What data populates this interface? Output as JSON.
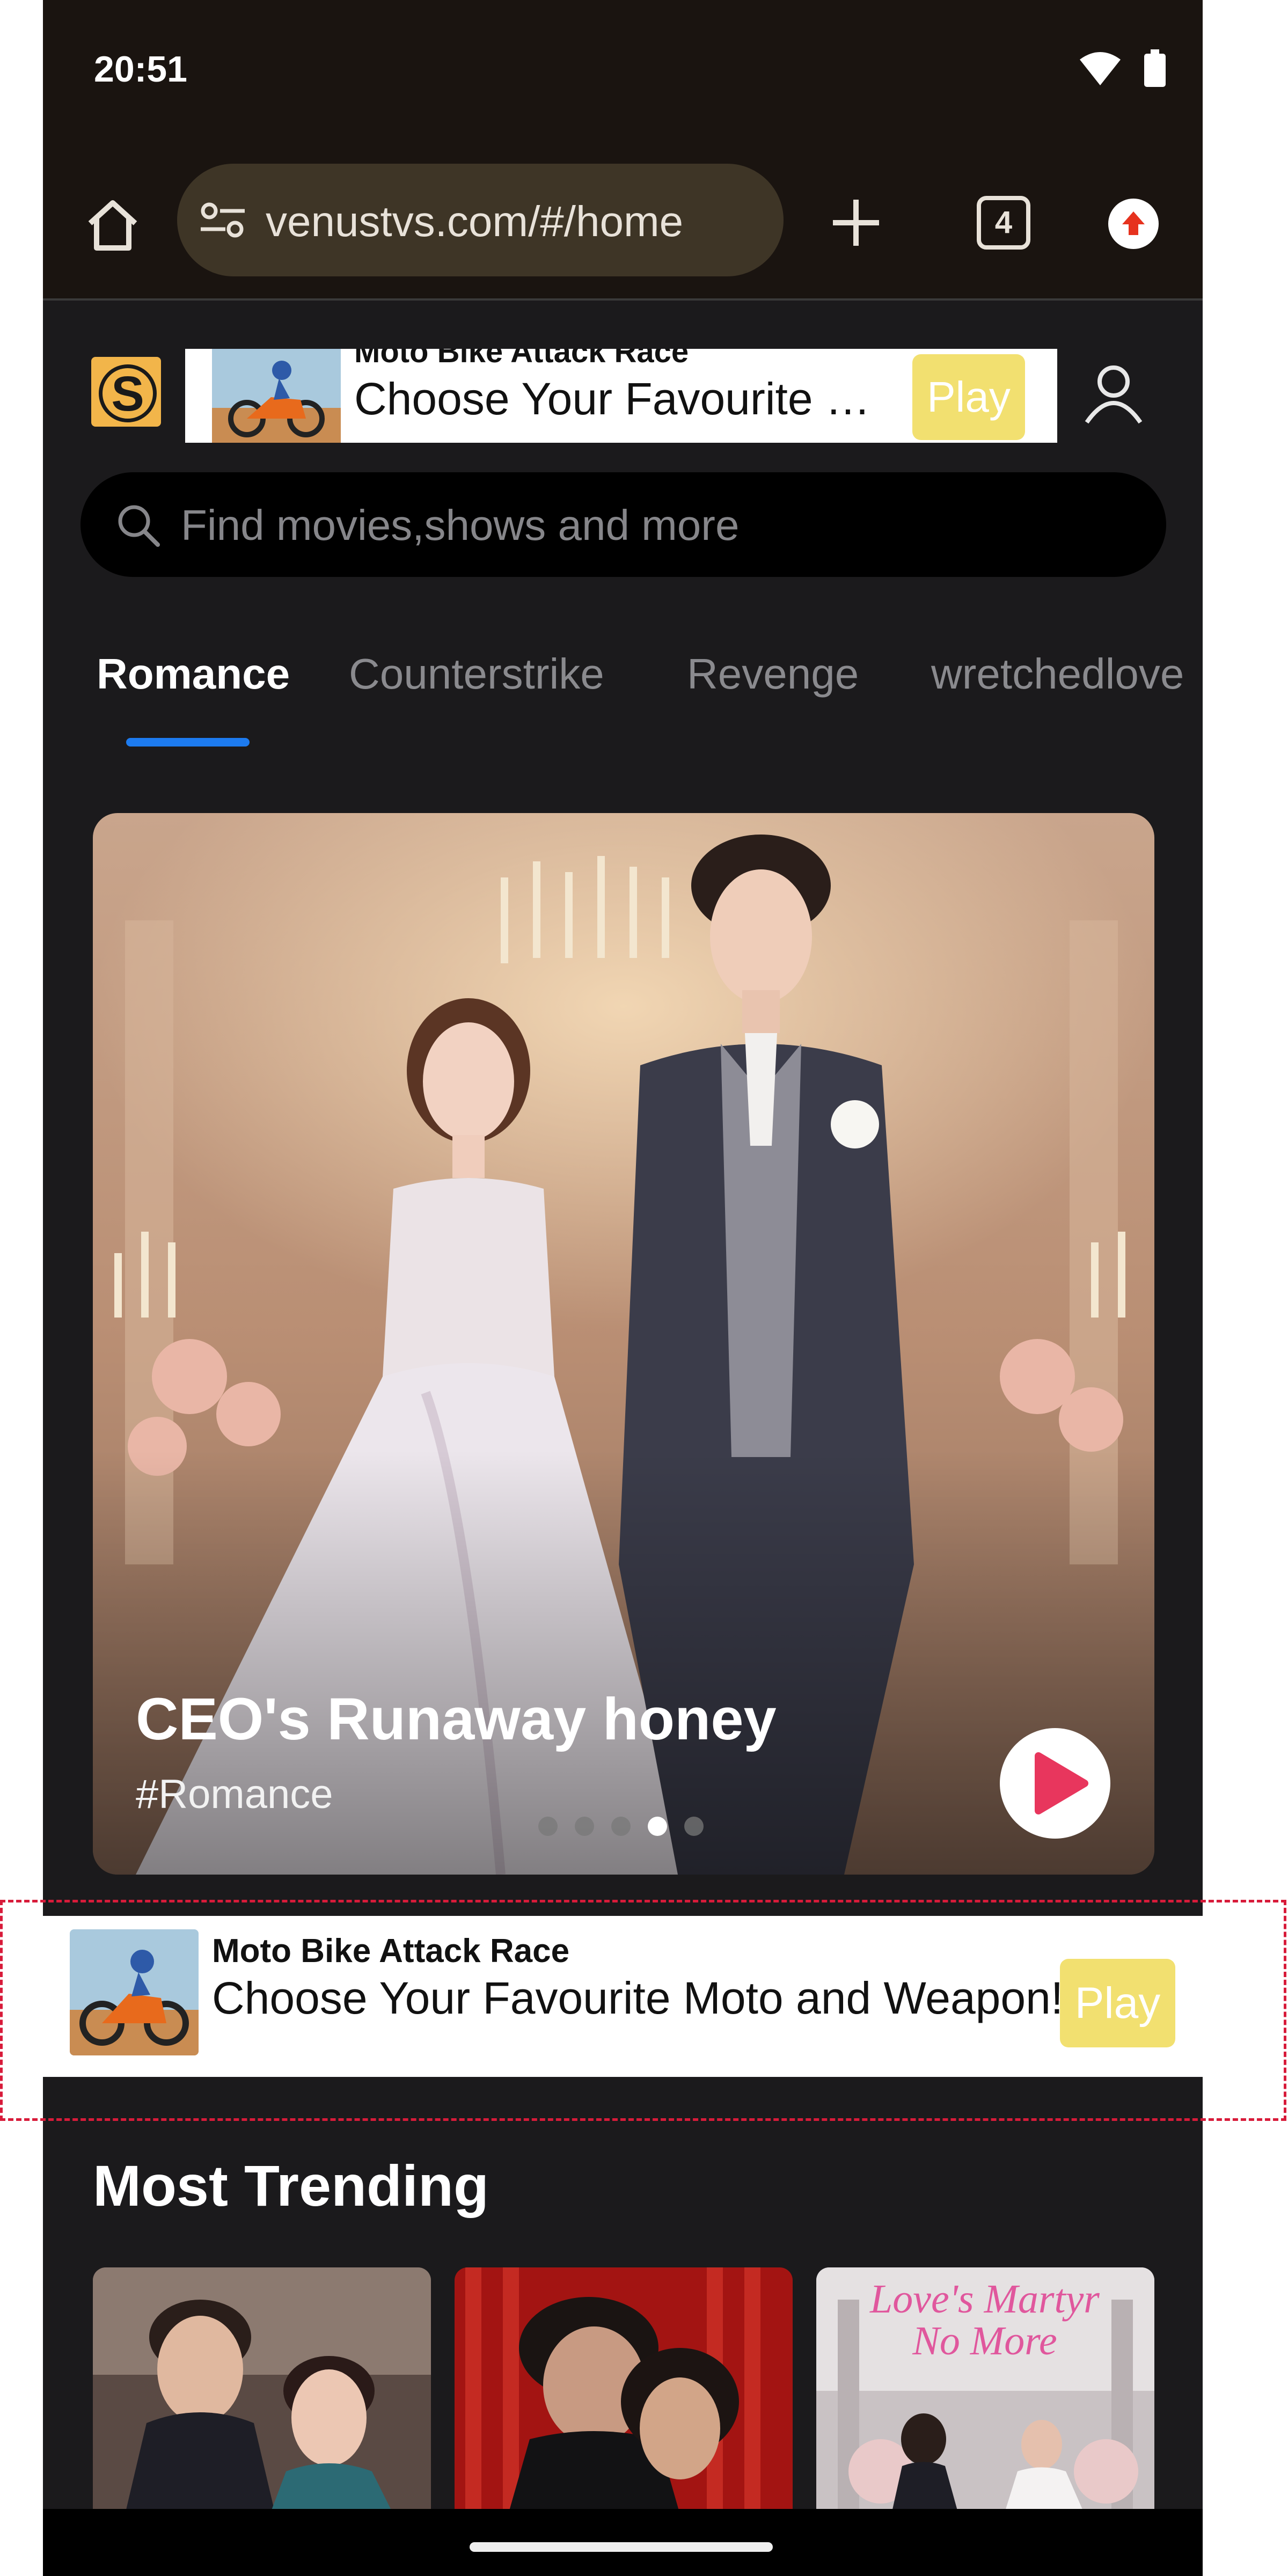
{
  "status_bar": {
    "time": "20:51",
    "wifi_icon": "wifi-icon",
    "battery_icon": "battery-icon"
  },
  "browser": {
    "url": "venustvs.com/#/home",
    "tab_count": "4",
    "icons": [
      "home-icon",
      "tune-icon",
      "plus-icon",
      "tabs-icon",
      "update-icon"
    ]
  },
  "header": {
    "logo_letter": "S",
    "ad": {
      "title": "Moto Bike Attack Race",
      "text": "Choose Your Favourite Moto and Weapon!",
      "play_label": "Play"
    },
    "account_icon": "user-icon"
  },
  "search": {
    "placeholder": "Find movies,shows and more",
    "icon": "search-icon"
  },
  "tabs": [
    {
      "label": "Romance",
      "active": true
    },
    {
      "label": "Counterstrike",
      "active": false
    },
    {
      "label": "Revenge",
      "active": false
    },
    {
      "label": "wretchedlove",
      "active": false
    }
  ],
  "hero": {
    "title": "CEO's Runaway honey",
    "tag": "#Romance",
    "slide_count": 5,
    "active_slide": 4,
    "play_icon": "play-icon"
  },
  "banner_ad": {
    "title": "Moto Bike Attack Race",
    "text": "Choose Your Favourite Moto and Weapon!",
    "play_label": "Play"
  },
  "trending": {
    "title": "Most Trending",
    "cards": [
      {
        "overlay": ""
      },
      {
        "overlay": ""
      },
      {
        "overlay": "Love's Martyr\nNo More"
      }
    ]
  },
  "colors": {
    "accent": "#1d7bef",
    "play_red": "#e8365d",
    "ad_button": "#f2e070",
    "background": "#1b1a1c"
  }
}
